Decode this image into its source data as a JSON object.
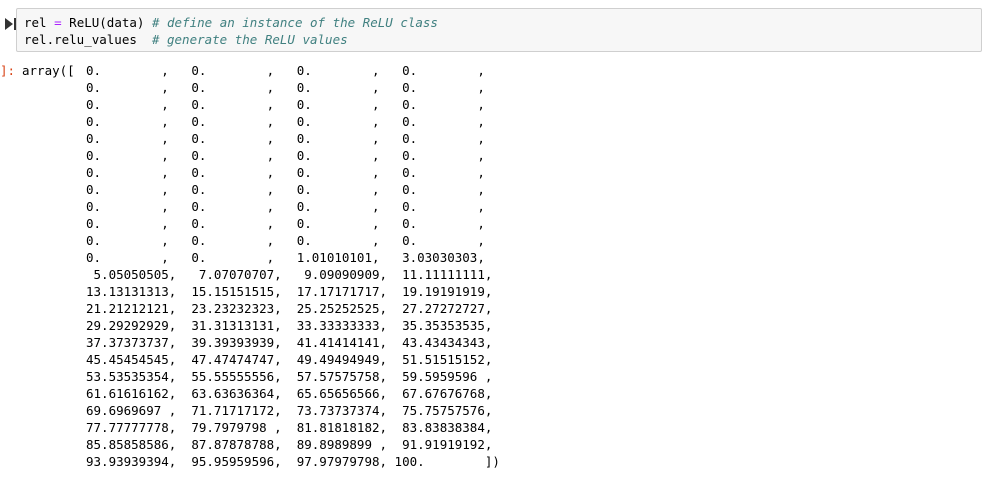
{
  "cell": {
    "code": {
      "line1": {
        "var": "rel",
        "op": "=",
        "call": "ReLU(data)",
        "comment": "# define an instance of the ReLU class"
      },
      "line2": {
        "expr": "rel.relu_values",
        "comment": "# generate the ReLU values"
      }
    },
    "output": {
      "prompt": "]:",
      "prefix": "array([",
      "lines": [
        "0.        ,   0.        ,   0.        ,   0.        ,",
        "0.        ,   0.        ,   0.        ,   0.        ,",
        "0.        ,   0.        ,   0.        ,   0.        ,",
        "0.        ,   0.        ,   0.        ,   0.        ,",
        "0.        ,   0.        ,   0.        ,   0.        ,",
        "0.        ,   0.        ,   0.        ,   0.        ,",
        "0.        ,   0.        ,   0.        ,   0.        ,",
        "0.        ,   0.        ,   0.        ,   0.        ,",
        "0.        ,   0.        ,   0.        ,   0.        ,",
        "0.        ,   0.        ,   0.        ,   0.        ,",
        "0.        ,   0.        ,   0.        ,   0.        ,",
        "0.        ,   0.        ,   1.01010101,   3.03030303,",
        " 5.05050505,   7.07070707,   9.09090909,  11.11111111,",
        "13.13131313,  15.15151515,  17.17171717,  19.19191919,",
        "21.21212121,  23.23232323,  25.25252525,  27.27272727,",
        "29.29292929,  31.31313131,  33.33333333,  35.35353535,",
        "37.37373737,  39.39393939,  41.41414141,  43.43434343,",
        "45.45454545,  47.47474747,  49.49494949,  51.51515152,",
        "53.53535354,  55.55555556,  57.57575758,  59.5959596 ,",
        "61.61616162,  63.63636364,  65.65656566,  67.67676768,",
        "69.6969697 ,  71.71717172,  73.73737374,  75.75757576,",
        "77.77777778,  79.7979798 ,  81.81818182,  83.83838384,",
        "85.85858586,  87.87878788,  89.8989899 ,  91.91919192,",
        "93.93939394,  95.95959596,  97.97979798, 100.        ])"
      ]
    }
  }
}
